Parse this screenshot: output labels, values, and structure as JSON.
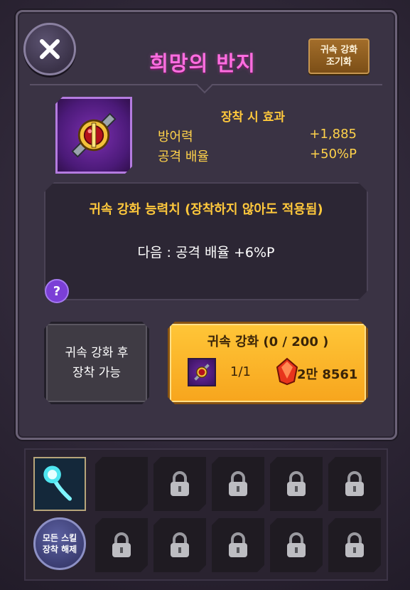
{
  "dialog": {
    "title": "희망의 반지",
    "early_bind_button": [
      "귀속 강화",
      "조기화"
    ]
  },
  "item": {
    "icon": "ring-icon",
    "effect_header": "장착 시 효과",
    "stats": [
      {
        "label": "방어력",
        "value": "+1,885"
      },
      {
        "label": "공격 배율",
        "value": "+50%P"
      }
    ]
  },
  "bound_stats": {
    "title": "귀속 강화 능력치 (장착하지 않아도 적용됨)",
    "next": "다음 : 공격 배율 +6%P",
    "help_label": "?"
  },
  "buttons": {
    "equip_after": [
      "귀속 강화 후",
      "장착 가능"
    ],
    "bind": {
      "title": "귀속 강화 (0 / 200 )",
      "material_count": "1/1",
      "cost": "2만 8561",
      "cost_icon": "red-gem-icon"
    }
  },
  "skill_tray": {
    "unequip_all": [
      "모든 스킬",
      "장착 해제"
    ],
    "equipped_skill_icon": "cyan-orb-skill-icon",
    "locked_slot_icon": "padlock-icon"
  },
  "colors": {
    "title": "#ff6de0",
    "gold_text": "#ffc83c",
    "bind_button": "#f7a51d"
  }
}
